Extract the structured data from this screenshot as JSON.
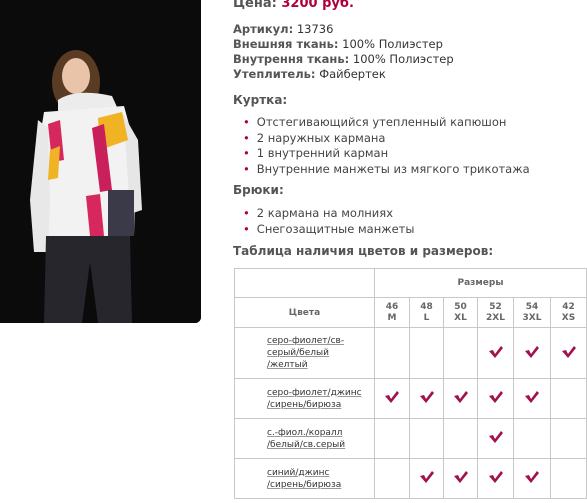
{
  "price": {
    "label": "Цена:",
    "value": "3200 руб."
  },
  "specs": [
    {
      "label": "Артикул:",
      "value": "13736"
    },
    {
      "label": "Внешняя ткань:",
      "value": "100% Полиэстер"
    },
    {
      "label": "Внутрення ткань:",
      "value": "100% Полиэстер"
    },
    {
      "label": "Утеплитель:",
      "value": "Файбертек"
    }
  ],
  "jacket": {
    "title": "Куртка:",
    "items": [
      "Отстегивающийся утепленный капюшон",
      "2 наружных кармана",
      "1 внутренний карман",
      "Внутренние манжеты из мягкого трикотажа"
    ]
  },
  "pants": {
    "title": "Брюки:",
    "items": [
      "2 кармана на молниях",
      "Снегозащитные манжеты"
    ]
  },
  "table": {
    "title": "Таблица наличия цветов и размеров:",
    "sizes_header": "Размеры",
    "colors_header": "Цвета",
    "sizes": [
      {
        "num": "46",
        "code": "M"
      },
      {
        "num": "48",
        "code": "L"
      },
      {
        "num": "50",
        "code": "XL"
      },
      {
        "num": "52",
        "code": "2XL"
      },
      {
        "num": "54",
        "code": "3XL"
      },
      {
        "num": "42",
        "code": "XS"
      }
    ],
    "rows": [
      {
        "lines": [
          "серо-фиолет/св-",
          "серый/белый",
          "/желтый"
        ],
        "avail": [
          false,
          false,
          false,
          true,
          true,
          true
        ]
      },
      {
        "lines": [
          "серо-фиолет/джинс",
          "/сирень/бирюза"
        ],
        "avail": [
          true,
          true,
          true,
          true,
          true,
          false
        ]
      },
      {
        "lines": [
          "с.-фиол./коралл",
          "/белый/св.серый"
        ],
        "avail": [
          false,
          false,
          false,
          true,
          false,
          false
        ]
      },
      {
        "lines": [
          "синий/джинс",
          "/сирень/бирюза"
        ],
        "avail": [
          false,
          true,
          true,
          true,
          true,
          false
        ]
      }
    ]
  },
  "colors": {
    "accent": "#b0003a",
    "check": "#a0124e",
    "border": "#c8c8c8"
  }
}
